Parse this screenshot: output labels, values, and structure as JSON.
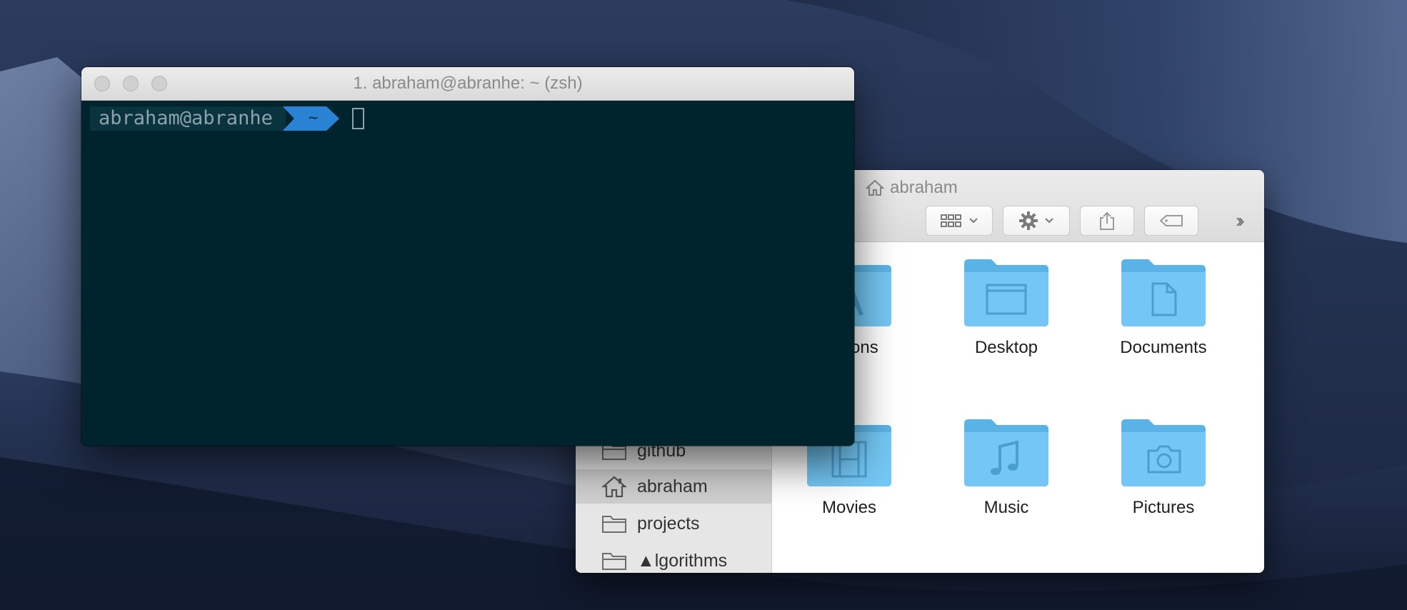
{
  "terminal": {
    "title": "1. abraham@abranhe: ~ (zsh)",
    "prompt_user": "abraham@abranhe",
    "prompt_dir": "~"
  },
  "finder": {
    "title": "abraham",
    "sidebar": {
      "items": [
        {
          "label": "github",
          "icon": "folder-icon"
        },
        {
          "label": "abraham",
          "icon": "home-icon",
          "selected": true
        },
        {
          "label": "projects",
          "icon": "folder-icon"
        },
        {
          "label": "▲lgorithms",
          "icon": "folder-icon"
        }
      ]
    },
    "items": [
      {
        "label": "ications",
        "icon": "applications-folder-icon"
      },
      {
        "label": "Desktop",
        "icon": "desktop-folder-icon"
      },
      {
        "label": "Documents",
        "icon": "documents-folder-icon"
      },
      {
        "label": "Movies",
        "icon": "movies-folder-icon"
      },
      {
        "label": "Music",
        "icon": "music-folder-icon"
      },
      {
        "label": "Pictures",
        "icon": "pictures-folder-icon"
      }
    ],
    "toolbar_icons": [
      "column-view-icon",
      "gallery-view-icon",
      "group-by-icon",
      "gear-icon",
      "share-icon",
      "tag-icon",
      "more-chevrons-icon"
    ]
  },
  "colors": {
    "terminal_bg": "#00242e",
    "prompt_dir_bg": "#2a82d4",
    "folder_blue": "#6cc4f2"
  }
}
